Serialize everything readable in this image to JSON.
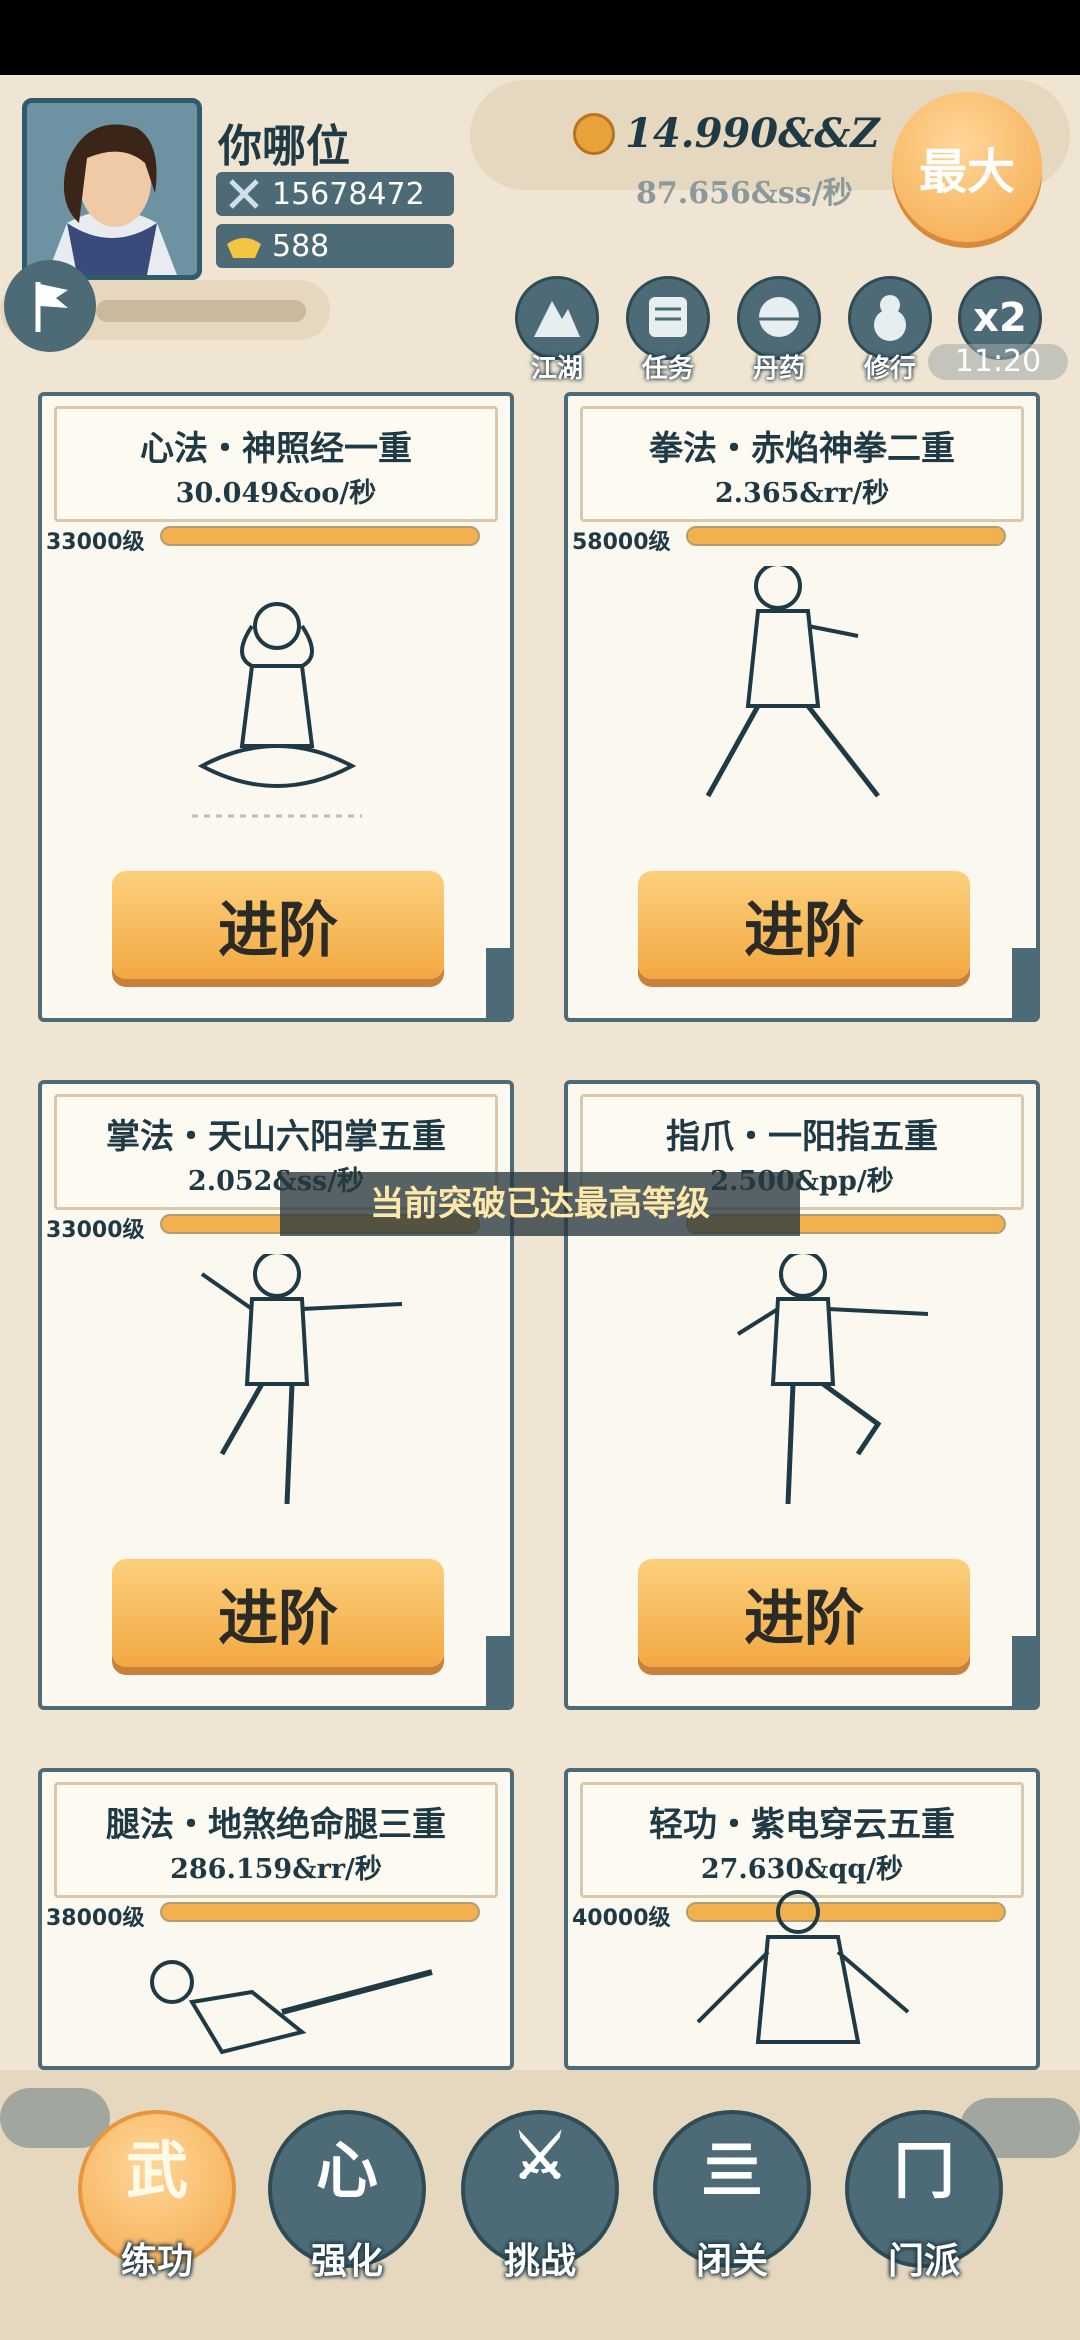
{
  "player": {
    "name": "你哪位",
    "power": "15678472",
    "ingots": "588"
  },
  "currency": {
    "gold_total": "14.990&&Z",
    "gold_rate": "87.656&ss/秒",
    "max_button": "最大"
  },
  "quick_menu": [
    {
      "label": "江湖",
      "icon": "mountain-icon"
    },
    {
      "label": "任务",
      "icon": "scroll-icon"
    },
    {
      "label": "丹药",
      "icon": "pill-icon"
    },
    {
      "label": "修行",
      "icon": "gourd-icon"
    }
  ],
  "speed": {
    "multiplier": "x2",
    "timer": "11:20"
  },
  "cards": [
    {
      "title": "心法・神照经一重",
      "rate": "30.049&oo/秒",
      "level": "33000级",
      "progress": 1.0,
      "button": "进阶"
    },
    {
      "title": "拳法・赤焰神拳二重",
      "rate": "2.365&rr/秒",
      "level": "58000级",
      "progress": 1.0,
      "button": "进阶"
    },
    {
      "title": "掌法・天山六阳掌五重",
      "rate": "2.052&ss/秒",
      "level": "33000级",
      "progress": 1.0,
      "button": "进阶"
    },
    {
      "title": "指爪・一阳指五重",
      "rate": "2.500&pp/秒",
      "level": "",
      "progress": 1.0,
      "button": "进阶"
    },
    {
      "title": "腿法・地煞绝命腿三重",
      "rate": "286.159&rr/秒",
      "level": "38000级",
      "progress": 1.0,
      "button": ""
    },
    {
      "title": "轻功・紫电穿云五重",
      "rate": "27.630&qq/秒",
      "level": "40000级",
      "progress": 1.0,
      "button": ""
    }
  ],
  "toast": "当前突破已达最高等级",
  "bottom_nav": [
    {
      "label": "练功",
      "glyph": "武",
      "active": true
    },
    {
      "label": "强化",
      "glyph": "心",
      "active": false
    },
    {
      "label": "挑战",
      "glyph": "⚔",
      "active": false
    },
    {
      "label": "闭关",
      "glyph": "亖",
      "active": false
    },
    {
      "label": "门派",
      "glyph": "冂",
      "active": false
    }
  ],
  "colors": {
    "accent": "#f2a841",
    "slate": "#4d6b77",
    "paper": "#fbf8ef"
  }
}
